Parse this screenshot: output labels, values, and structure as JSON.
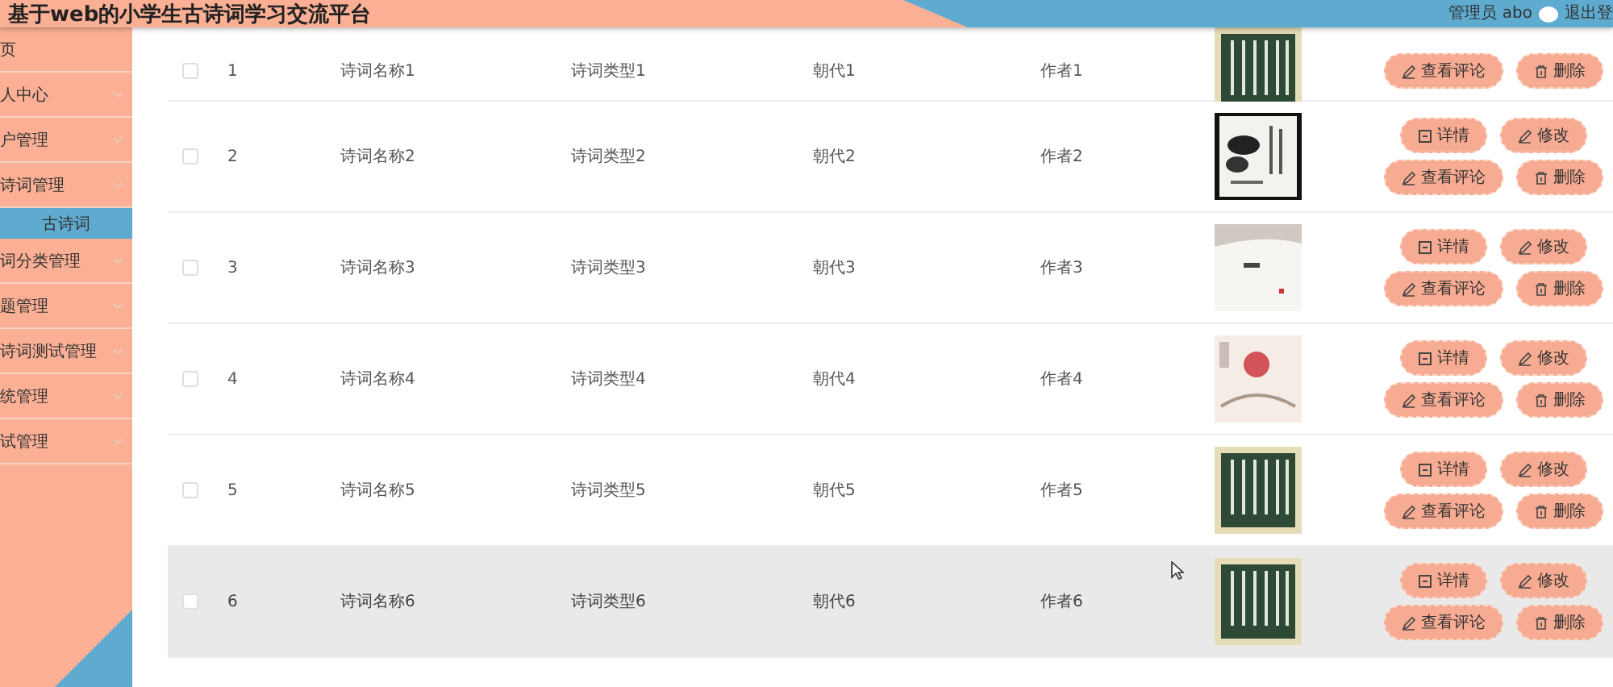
{
  "header": {
    "title": "基于web的小学生古诗词学习交流平台",
    "user": "管理员 abo",
    "logout": "退出登"
  },
  "sidebar": {
    "items": [
      {
        "label": "页",
        "expandable": false,
        "selected": false
      },
      {
        "label": "人中心",
        "expandable": true,
        "selected": false
      },
      {
        "label": "户管理",
        "expandable": true,
        "selected": false
      },
      {
        "label": "诗词管理",
        "expandable": true,
        "selected": false,
        "children": [
          {
            "label": "古诗词",
            "selected": true
          }
        ]
      },
      {
        "label": "词分类管理",
        "expandable": true,
        "selected": false
      },
      {
        "label": "题管理",
        "expandable": true,
        "selected": false
      },
      {
        "label": "诗词测试管理",
        "expandable": true,
        "selected": false
      },
      {
        "label": "统管理",
        "expandable": true,
        "selected": false
      },
      {
        "label": "试管理",
        "expandable": true,
        "selected": false
      }
    ]
  },
  "table": {
    "rows": [
      {
        "checked": false,
        "highlighted": false,
        "index": "1",
        "name": "诗词名称1",
        "type": "诗词类型1",
        "dynasty": "朝代1",
        "author": "作者1",
        "buttons": [
          {
            "kind": "comment",
            "label": "查看评论"
          },
          {
            "kind": "delete",
            "label": "删除"
          }
        ]
      },
      {
        "checked": false,
        "highlighted": false,
        "index": "2",
        "name": "诗词名称2",
        "type": "诗词类型2",
        "dynasty": "朝代2",
        "author": "作者2",
        "buttons": [
          {
            "kind": "detail",
            "label": "详情"
          },
          {
            "kind": "edit",
            "label": "修改"
          },
          {
            "kind": "comment",
            "label": "查看评论"
          },
          {
            "kind": "delete",
            "label": "删除"
          }
        ]
      },
      {
        "checked": false,
        "highlighted": false,
        "index": "3",
        "name": "诗词名称3",
        "type": "诗词类型3",
        "dynasty": "朝代3",
        "author": "作者3",
        "buttons": [
          {
            "kind": "detail",
            "label": "详情"
          },
          {
            "kind": "edit",
            "label": "修改"
          },
          {
            "kind": "comment",
            "label": "查看评论"
          },
          {
            "kind": "delete",
            "label": "删除"
          }
        ]
      },
      {
        "checked": false,
        "highlighted": false,
        "index": "4",
        "name": "诗词名称4",
        "type": "诗词类型4",
        "dynasty": "朝代4",
        "author": "作者4",
        "buttons": [
          {
            "kind": "detail",
            "label": "详情"
          },
          {
            "kind": "edit",
            "label": "修改"
          },
          {
            "kind": "comment",
            "label": "查看评论"
          },
          {
            "kind": "delete",
            "label": "删除"
          }
        ]
      },
      {
        "checked": false,
        "highlighted": false,
        "index": "5",
        "name": "诗词名称5",
        "type": "诗词类型5",
        "dynasty": "朝代5",
        "author": "作者5",
        "buttons": [
          {
            "kind": "detail",
            "label": "详情"
          },
          {
            "kind": "edit",
            "label": "修改"
          },
          {
            "kind": "comment",
            "label": "查看评论"
          },
          {
            "kind": "delete",
            "label": "删除"
          }
        ]
      },
      {
        "checked": false,
        "highlighted": true,
        "index": "6",
        "name": "诗词名称6",
        "type": "诗词类型6",
        "dynasty": "朝代6",
        "author": "作者6",
        "buttons": [
          {
            "kind": "detail",
            "label": "详情"
          },
          {
            "kind": "edit",
            "label": "修改"
          },
          {
            "kind": "comment",
            "label": "查看评论"
          },
          {
            "kind": "delete",
            "label": "删除"
          }
        ]
      }
    ]
  }
}
